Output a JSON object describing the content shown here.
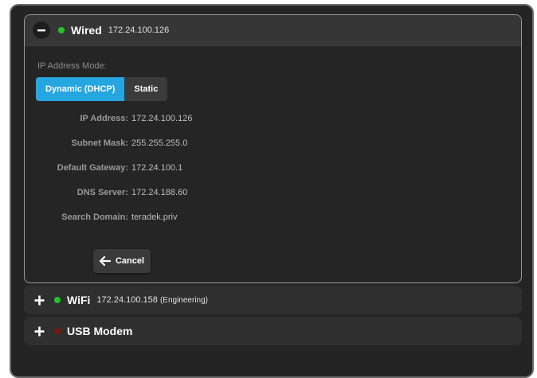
{
  "sections": {
    "wired": {
      "title": "Wired",
      "ip": "172.24.100.126",
      "status_color": "#22c32a",
      "toggle_icon": "minus-icon"
    },
    "wifi": {
      "title": "WiFi",
      "ip": "172.24.100.158",
      "network": "(Engineering)",
      "status_color": "#22c32a",
      "toggle_icon": "plus-icon"
    },
    "usb": {
      "title": "USB Modem",
      "status_color": "#7a1616",
      "toggle_icon": "plus-icon"
    }
  },
  "wired_panel": {
    "mode_label": "IP Address Mode:",
    "modes": {
      "dynamic": "Dynamic (DHCP)",
      "static": "Static",
      "selected": "Dynamic (DHCP)"
    },
    "fields": {
      "ip_label": "IP Address:",
      "ip_value": "172.24.100.126",
      "subnet_label": "Subnet Mask:",
      "subnet_value": "255.255.255.0",
      "gateway_label": "Default Gateway:",
      "gateway_value": "172.24.100.1",
      "dns_label": "DNS Server:",
      "dns_value": "172.24.188.60",
      "domain_label": "Search Domain:",
      "domain_value": "teradek.priv"
    },
    "cancel_label": "Cancel",
    "cancel_icon": "arrow-left-icon"
  },
  "colors": {
    "accent": "#26a6e0",
    "connected": "#22c32a",
    "disconnected": "#7a1616"
  }
}
